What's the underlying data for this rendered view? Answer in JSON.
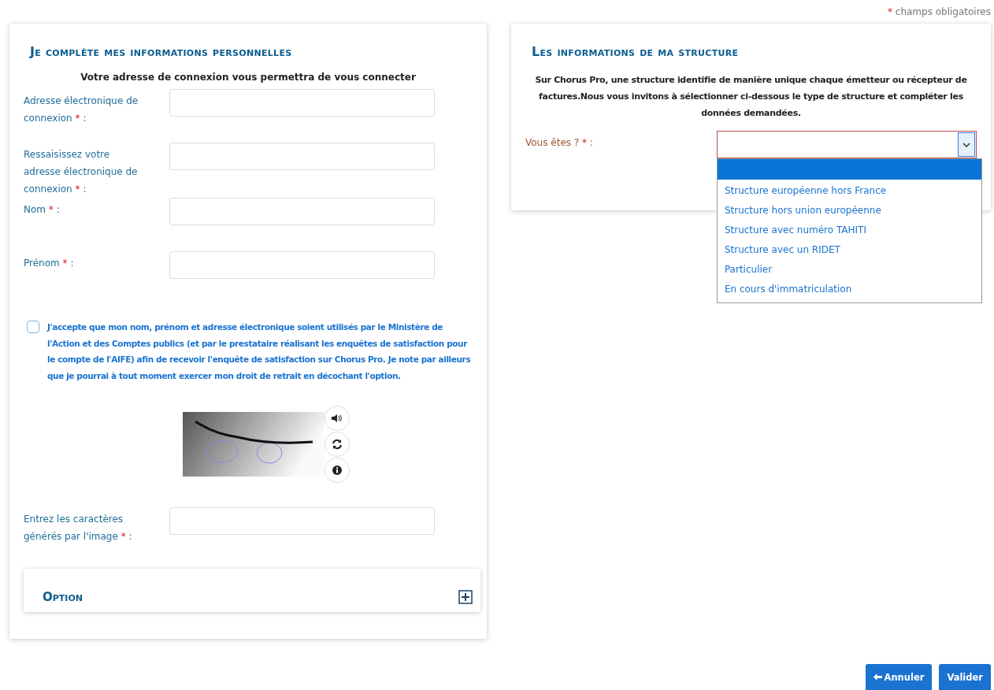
{
  "required_note": {
    "mark": "*",
    "text": "champs obligatoires"
  },
  "personal": {
    "title": "Je complète mes informations personnelles",
    "subtitle": "Votre adresse de connexion vous permettra de vous connecter",
    "fields": [
      {
        "label": "Adresse électronique de connexion",
        "mark": "*",
        "colon": ":"
      },
      {
        "label": "Ressaisissez votre adresse électronique de connexion",
        "mark": "*",
        "colon": ":"
      },
      {
        "label": "Nom",
        "mark": "*",
        "colon": ":"
      },
      {
        "label": "Prénom",
        "mark": "*",
        "colon": ":"
      }
    ],
    "consent": {
      "checked": false,
      "text": "J'accepte que mon nom, prénom et adresse électronique soient utilisés par le Ministère de l'Action et des Comptes publics (et par le prestataire réalisant les enquêtes de satisfaction pour le compte de l'AIFE) afin de recevoir l'enquête de satisfaction sur Chorus Pro. Je note par ailleurs que je pourrai à tout moment exercer mon droit de retrait en décochant l'option."
    },
    "captcha": {
      "input": {
        "label": "Entrez les caractères générés par l'image",
        "mark": "*",
        "colon": ":"
      }
    },
    "option": {
      "title": "Option",
      "expanded": false
    }
  },
  "structure": {
    "title": "Les informations de ma structure",
    "description": "Sur Chorus Pro, une structure identifie de manière unique chaque émetteur ou récepteur de factures.Nous vous invitons à sélectionner ci-dessous le type de structure et compléter les données demandées.",
    "select": {
      "label": "Vous êtes ?",
      "mark": "*",
      "colon": ":",
      "expanded": true,
      "options": [
        {
          "selected": true
        },
        {
          "label": "Structure européenne hors France",
          "selected": false
        },
        {
          "label": "Structure hors union européenne",
          "selected": false
        },
        {
          "label": "Structure avec numéro TAHITI",
          "selected": false
        },
        {
          "label": "Structure avec un RIDET",
          "selected": false
        },
        {
          "label": "Particulier",
          "selected": false
        },
        {
          "label": "En cours d'immatriculation",
          "selected": false
        }
      ]
    }
  },
  "buttons": [
    {
      "kind": "back",
      "label": "Annuler"
    },
    {
      "kind": "submit",
      "label": "Valider"
    }
  ]
}
